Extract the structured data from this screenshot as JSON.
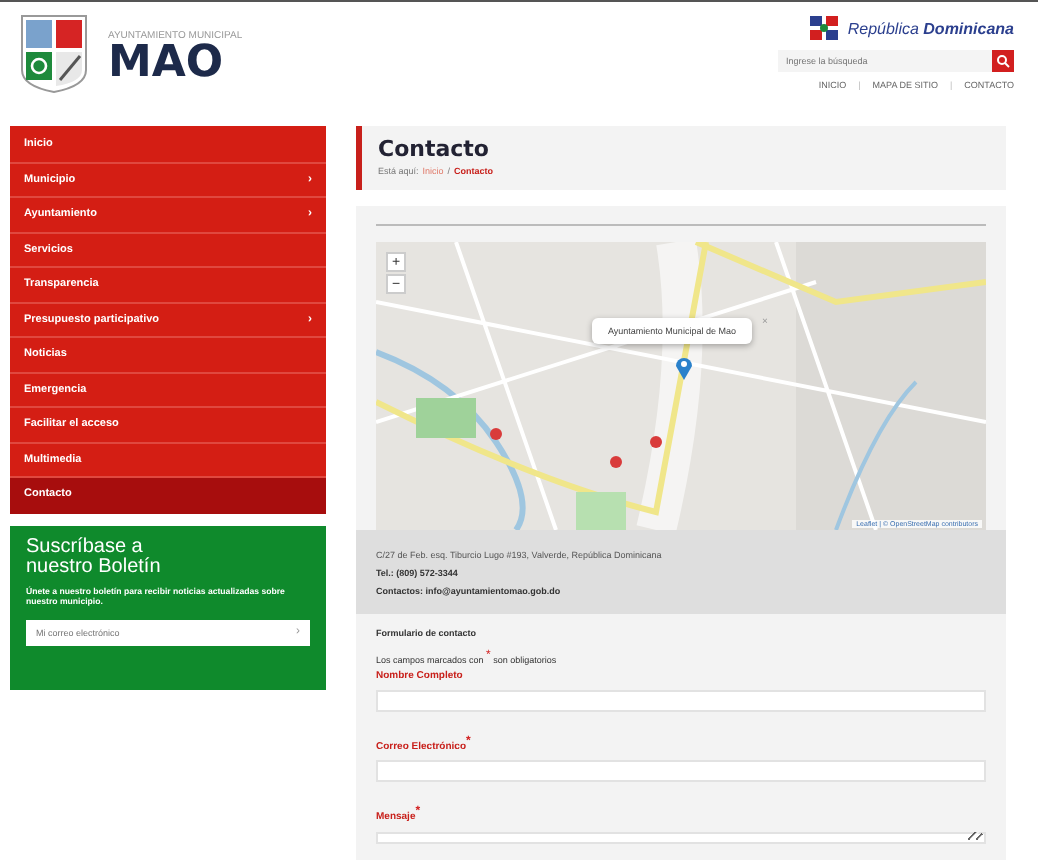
{
  "header": {
    "subtitle": "AYUNTAMIENTO MUNICIPAL",
    "title": "MAO",
    "country": "República **Dominicana**",
    "search": {
      "placeholder": "Ingrese la búsqueda"
    },
    "links": [
      {
        "kind": "link",
        "label": "INICIO"
      },
      {
        "kind": "sep",
        "label": "|"
      },
      {
        "kind": "link",
        "label": "MAPA DE SITIO"
      },
      {
        "kind": "sep",
        "label": "|"
      },
      {
        "kind": "link",
        "label": "CONTACTO"
      }
    ]
  },
  "sidebar": {
    "items": [
      {
        "label": "Inicio",
        "has_submenu": false,
        "selected": false
      },
      {
        "label": "Municipio",
        "has_submenu": true,
        "selected": false
      },
      {
        "label": "Ayuntamiento",
        "has_submenu": true,
        "selected": false
      },
      {
        "label": "Servicios",
        "has_submenu": false,
        "selected": false
      },
      {
        "label": "Transparencia",
        "has_submenu": false,
        "selected": false
      },
      {
        "label": "Presupuesto participativo",
        "has_submenu": true,
        "selected": false
      },
      {
        "label": "Noticias",
        "has_submenu": false,
        "selected": false
      },
      {
        "label": "Emergencia",
        "has_submenu": false,
        "selected": false
      },
      {
        "label": "Facilitar el acceso",
        "has_submenu": false,
        "selected": false
      },
      {
        "label": "Multimedia",
        "has_submenu": false,
        "selected": false
      },
      {
        "label": "Contacto",
        "has_submenu": false,
        "selected": true
      }
    ],
    "submenu_arrow": "›",
    "newsletter": {
      "title": "Suscríbase a nuestro Boletín",
      "text": "Únete a nuestro boletín para recibir noticias actualizadas sobre nuestro municipio.",
      "placeholder": "Mi correo electrónico",
      "button": "›"
    }
  },
  "main": {
    "title": "Contacto",
    "breadcrumb": [
      {
        "kind": "text",
        "label": "Está aquí:"
      },
      {
        "kind": "link",
        "label": "Inicio"
      },
      {
        "kind": "sep",
        "label": "/"
      },
      {
        "kind": "current",
        "label": "Contacto"
      }
    ],
    "map": {
      "zoom_in": "+",
      "zoom_out": "−",
      "popup": "Ayuntamiento Municipal de Mao",
      "popup_close": "×",
      "attribution": "Leaflet | © OpenStreetMap contributors"
    },
    "info": [
      {
        "kind": "plain",
        "text": "C/27 de Feb. esq. Tiburcio Lugo #193, Valverde, República Dominicana"
      },
      {
        "kind": "strong",
        "text": "Tel.: (809) 572-3344"
      },
      {
        "kind": "strong",
        "text": "Contactos: info@ayuntamientomao.gob.do"
      }
    ],
    "form": {
      "title": "Formulario de contacto",
      "note": "Los campos marcados con $^{*}$ son obligatorios",
      "fields": [
        {
          "label": "Nombre Completo",
          "kind": "input"
        },
        {
          "label": "Correo Electrónico$^{*}$",
          "kind": "input"
        },
        {
          "label": "Mensaje$^{*}$",
          "kind": "textarea"
        }
      ]
    }
  }
}
